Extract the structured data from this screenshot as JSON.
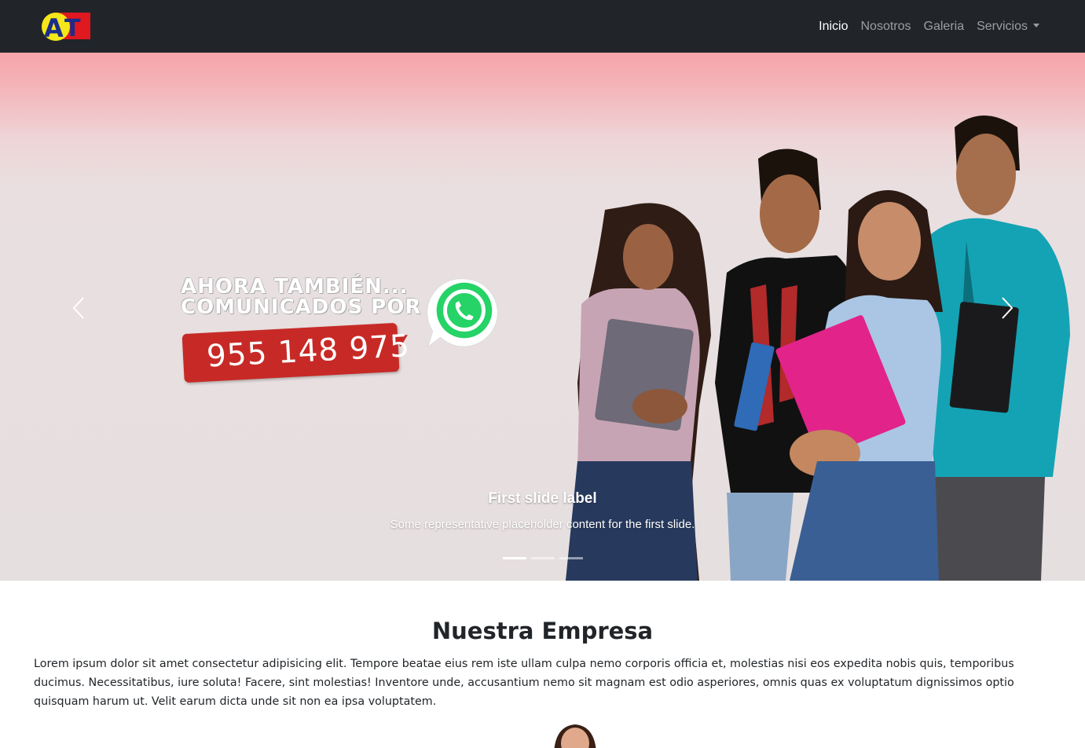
{
  "navbar": {
    "logo_text": "AT",
    "links": [
      {
        "label": "Inicio",
        "active": true
      },
      {
        "label": "Nosotros",
        "active": false
      },
      {
        "label": "Galeria",
        "active": false
      },
      {
        "label": "Servicios",
        "active": false,
        "dropdown": true
      }
    ]
  },
  "carousel": {
    "promo_line_1": "AHORA TAMBIÉN...",
    "promo_line_2": "COMUNICADOS POR",
    "phone": "955 148 975",
    "caption_title": "First slide label",
    "caption_text": "Some representative placeholder content for the first slide.",
    "slide_count": 3,
    "active_slide": 1
  },
  "section": {
    "title": "Nuestra Empresa",
    "body": "Lorem ipsum dolor sit amet consectetur adipisicing elit. Tempore beatae eius rem iste ullam culpa nemo corporis officia et, molestias nisi eos expedita nobis quis, temporibus ducimus. Necessitatibus, iure soluta! Facere, sint molestias! Inventore unde, accusantium nemo sit magnam est odio asperiores, omnis quas ex voluptatum dignissimos optio quisquam harum ut. Velit earum dicta unde sit non ea ipsa voluptatem."
  },
  "colors": {
    "navbar_bg": "#212529",
    "phone_badge": "#c72a26",
    "whatsapp_green": "#25d366"
  }
}
